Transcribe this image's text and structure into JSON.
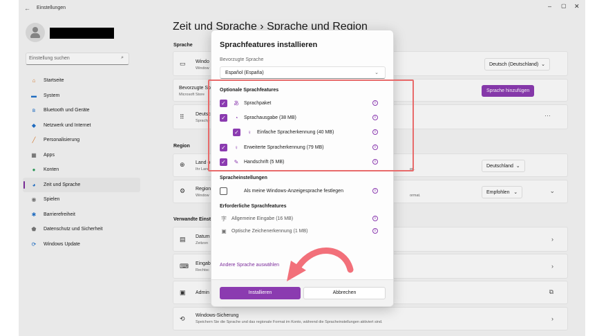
{
  "window": {
    "app_title": "Einstellungen",
    "controls": {
      "minimize": "–",
      "maximize": "▢",
      "close": "✕"
    }
  },
  "sidebar": {
    "search_placeholder": "Einstellung suchen",
    "items": [
      {
        "label": "Startseite",
        "icon": "home-icon",
        "glyph": "⌂",
        "color": "#d97a2b"
      },
      {
        "label": "System",
        "icon": "monitor-icon",
        "glyph": "▬",
        "color": "#1f6fc7"
      },
      {
        "label": "Bluetooth und Geräte",
        "icon": "bluetooth-icon",
        "glyph": "ʙ",
        "color": "#1f6fc7"
      },
      {
        "label": "Netzwerk und Internet",
        "icon": "wifi-icon",
        "glyph": "◆",
        "color": "#1f6fc7"
      },
      {
        "label": "Personalisierung",
        "icon": "brush-icon",
        "glyph": "╱",
        "color": "#d97a2b"
      },
      {
        "label": "Apps",
        "icon": "apps-icon",
        "glyph": "▦",
        "color": "#555555"
      },
      {
        "label": "Konten",
        "icon": "account-icon",
        "glyph": "●",
        "color": "#2e9e5b"
      },
      {
        "label": "Zeit und Sprache",
        "icon": "globe-clock-icon",
        "glyph": "◕",
        "color": "#1f6fc7"
      },
      {
        "label": "Spielen",
        "icon": "gamepad-icon",
        "glyph": "◉",
        "color": "#777777"
      },
      {
        "label": "Barrierefreiheit",
        "icon": "accessibility-icon",
        "glyph": "✱",
        "color": "#1f6fc7"
      },
      {
        "label": "Datenschutz und Sicherheit",
        "icon": "shield-icon",
        "glyph": "⬟",
        "color": "#777777"
      },
      {
        "label": "Windows Update",
        "icon": "update-icon",
        "glyph": "⟳",
        "color": "#1f6fc7"
      }
    ],
    "active_index": 7
  },
  "page": {
    "title": "Zeit und Sprache  ›  Sprache und Region",
    "section_language": "Sprache",
    "section_region": "Region",
    "section_related": "Verwandte Einst",
    "windows_display_lang_title": "Windo",
    "windows_display_lang_sub": "Window",
    "windows_display_lang_value": "Deutsch (Deutschland)",
    "preferred_lang_title": "Bevorzugte Sp",
    "preferred_lang_sub": "Microsoft Store",
    "add_language_button": "Sprache hinzufügen",
    "deutsch_title": "Deutsc",
    "deutsch_sub": "Sprachp",
    "deutsch_more": "···",
    "country_title": "Land o",
    "country_sub": "Ihr Lanc",
    "country_trail": "en.",
    "country_value": "Deutschland",
    "regional_title": "Region",
    "regional_sub": "Window",
    "regional_trail": "ormat.",
    "regional_value": "Empfohlen",
    "datetime_title": "Datum",
    "datetime_sub": "Zeitzon",
    "input_title": "Eingab",
    "input_sub": "Rechtsc",
    "admin_title": "Admin",
    "backup_title": "Windows-Sicherung",
    "backup_sub": "Speichern Sie die Sprache und das regionale Format im Konto, während die Spracheinstellungen aktiviert sind."
  },
  "dialog": {
    "title": "Sprachfeatures installieren",
    "preferred_label": "Bevorzugte Sprache",
    "preferred_value": "Español (España)",
    "optional_heading": "Optionale Sprachfeatures",
    "optional_features": [
      {
        "label": "Sprachpaket",
        "icon": "language-pack-icon",
        "glyph": "あ",
        "checked": true,
        "indent": false
      },
      {
        "label": "Sprachausgabe (38 MB)",
        "icon": "speech-icon",
        "glyph": "◔",
        "checked": true,
        "indent": false
      },
      {
        "label": "Einfache Spracherkennung (40 MB)",
        "icon": "microphone-icon",
        "glyph": "♀",
        "checked": true,
        "indent": true
      },
      {
        "label": "Erweiterte Spracherkennung (79 MB)",
        "icon": "microphone-icon",
        "glyph": "♀",
        "checked": true,
        "indent": false
      },
      {
        "label": "Handschrift (5 MB)",
        "icon": "handwriting-icon",
        "glyph": "✎",
        "checked": true,
        "indent": false
      }
    ],
    "settings_heading": "Spracheinstellungen",
    "settings_option": "Als meine Windows-Anzeigesprache festlegen",
    "settings_checked": false,
    "required_heading": "Erforderliche Sprachfeatures",
    "required_features": [
      {
        "label": "Allgemeine Eingabe (16 MB)",
        "icon": "keyboard-input-icon",
        "glyph": "字"
      },
      {
        "label": "Optische Zeichenerkennung (1 MB)",
        "icon": "ocr-icon",
        "glyph": "▣"
      }
    ],
    "other_language_link": "Andere Sprache auswählen",
    "install_button": "Installieren",
    "cancel_button": "Abbrechen"
  },
  "colors": {
    "accent": "#8b3bb0",
    "highlight_box": "#e86a6a",
    "arrow": "#f2707a"
  }
}
